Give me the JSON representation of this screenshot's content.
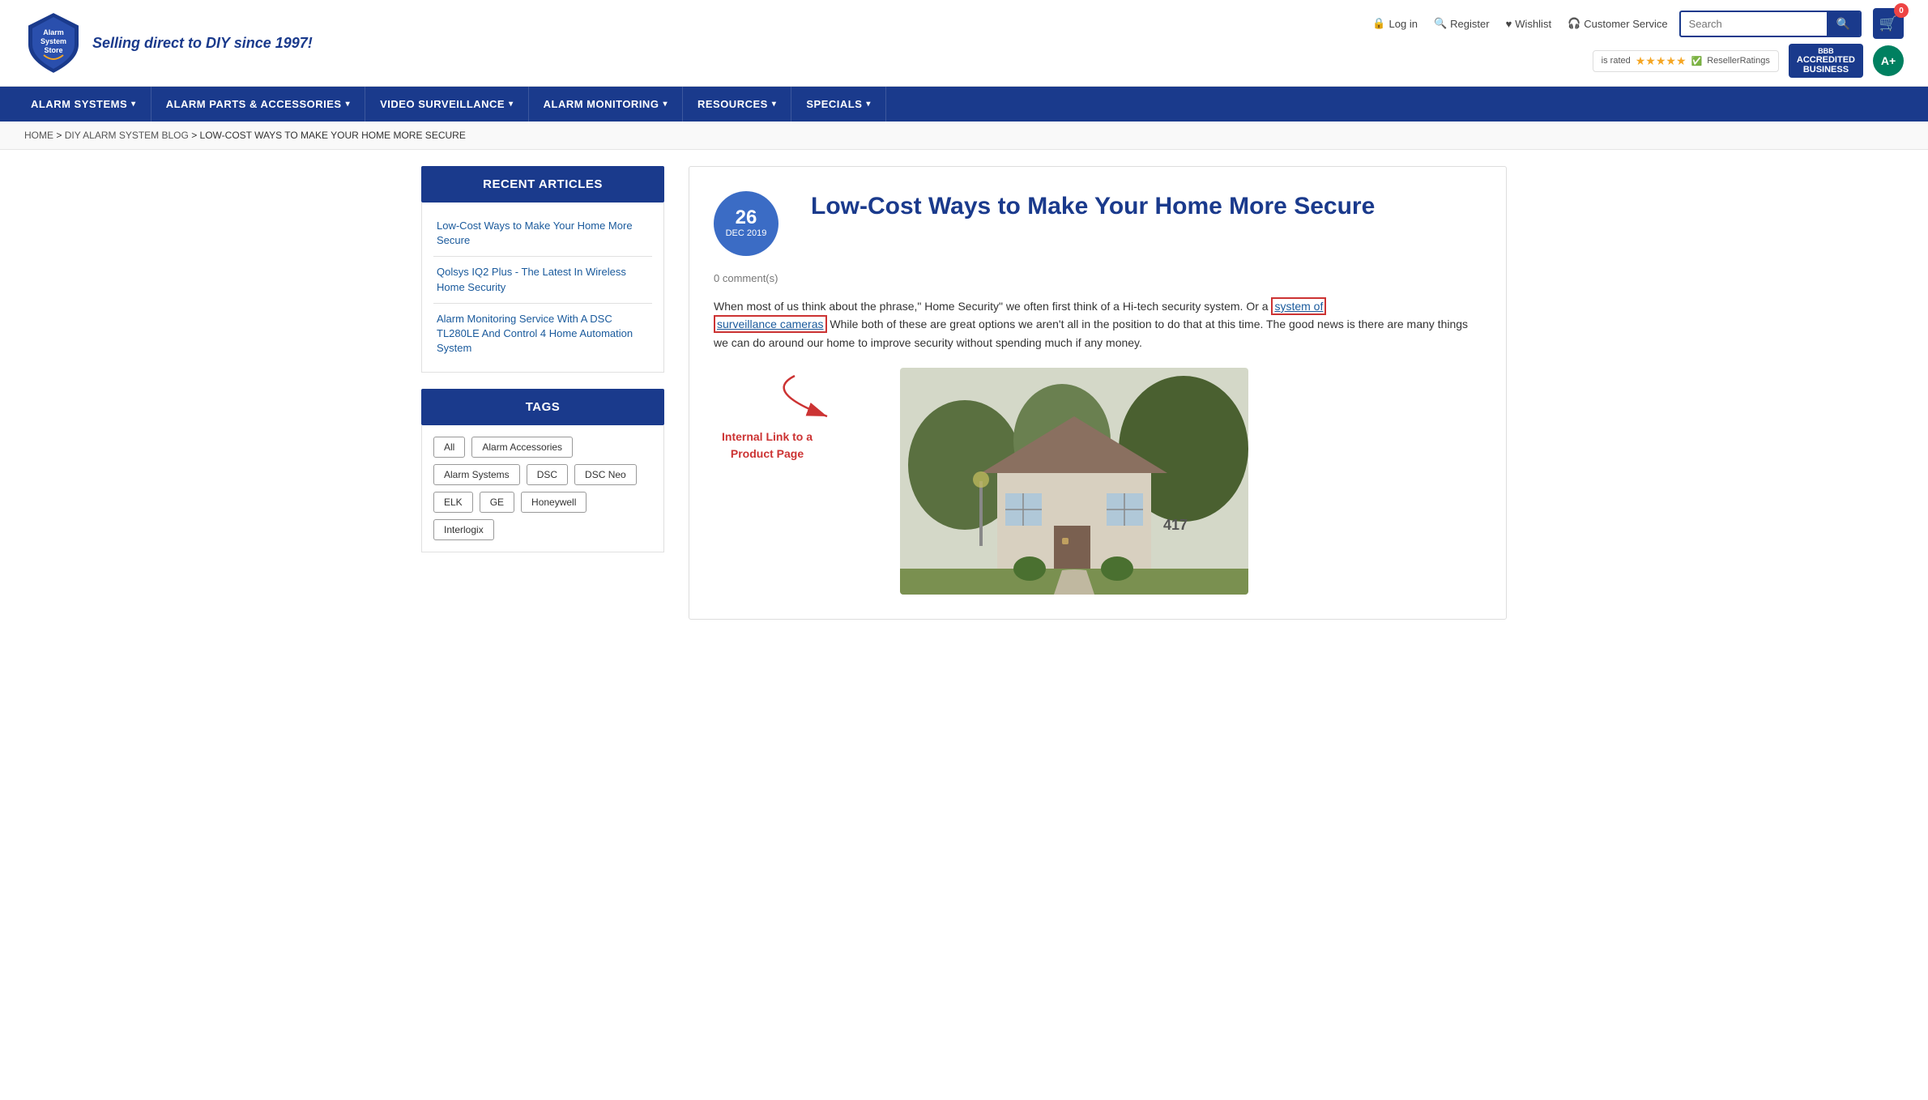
{
  "header": {
    "tagline": "Selling direct to DIY since 1997!",
    "top_links": [
      {
        "label": "Log in",
        "icon": "lock"
      },
      {
        "label": "Register",
        "icon": "search-person"
      },
      {
        "label": "Wishlist",
        "icon": "heart"
      },
      {
        "label": "Customer Service",
        "icon": "headset"
      }
    ],
    "search_placeholder": "Search",
    "cart_count": "0",
    "reseller_label": "is rated",
    "reseller_sub": "ResellerRatings",
    "bbb_label": "ACCREDITED\nBUSINESS",
    "bbb_sub": "BBB",
    "ap_label": "A+"
  },
  "nav": {
    "items": [
      {
        "label": "ALARM SYSTEMS",
        "has_dropdown": true
      },
      {
        "label": "ALARM PARTS & ACCESSORIES",
        "has_dropdown": true
      },
      {
        "label": "VIDEO SURVEILLANCE",
        "has_dropdown": true
      },
      {
        "label": "ALARM MONITORING",
        "has_dropdown": true
      },
      {
        "label": "RESOURCES",
        "has_dropdown": true
      },
      {
        "label": "SPECIALS",
        "has_dropdown": true
      }
    ]
  },
  "breadcrumb": {
    "items": [
      "HOME",
      "DIY ALARM SYSTEM BLOG",
      "LOW-COST WAYS TO MAKE YOUR HOME MORE SECURE"
    ]
  },
  "sidebar": {
    "recent_articles_title": "RECENT ARTICLES",
    "articles": [
      {
        "title": "Low-Cost Ways to Make Your Home More Secure"
      },
      {
        "title": "Qolsys IQ2 Plus - The Latest In Wireless Home Security"
      },
      {
        "title": "Alarm Monitoring Service With A DSC TL280LE And Control 4 Home Automation System"
      }
    ],
    "tags_title": "TAGS",
    "tags": [
      "All",
      "Alarm Accessories",
      "Alarm Systems",
      "DSC",
      "DSC Neo",
      "ELK",
      "GE",
      "Honeywell",
      "Interlogix"
    ]
  },
  "article": {
    "date_day": "26",
    "date_month": "DEC 2019",
    "title": "Low-Cost Ways to Make Your Home More Secure",
    "comment_count": "0 comment(s)",
    "body_text_1": "When most of us think about the phrase,\" Home Security\" we often first think of a Hi-tech security system. Or a ",
    "link_1_text": "system of",
    "link_2_text": "surveillance cameras",
    "body_text_2": " While both of these are great options we aren't all in the position to do that at this time. The good news is there are many things we can do around our home to improve security without spending much if any money.",
    "annotation_label": "Internal Link to a\nProduct Page"
  }
}
